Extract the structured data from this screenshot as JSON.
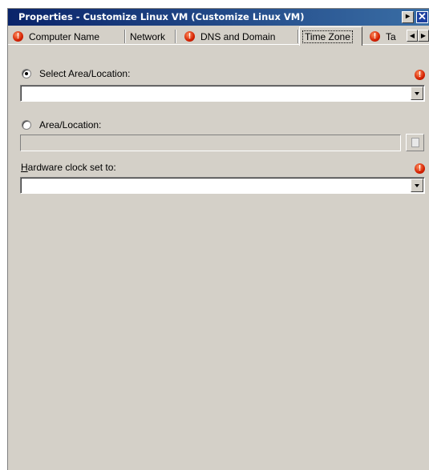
{
  "window": {
    "title": "Properties - Customize Linux VM (Customize Linux VM)",
    "menu_glyph": "▸",
    "close_glyph": "✕"
  },
  "tabs": [
    {
      "label": "Computer Name",
      "error": true
    },
    {
      "label": "Network",
      "error": false
    },
    {
      "label": "DNS and Domain",
      "error": true
    },
    {
      "label": "Time Zone",
      "error": false,
      "active": true
    },
    {
      "label": "Ta",
      "error": true
    }
  ],
  "tab_scroll": {
    "left": "◀",
    "right": "▶"
  },
  "form": {
    "select_area": {
      "label": "Select Area/Location:",
      "selected": true,
      "value": "",
      "error": true
    },
    "area_location": {
      "label": "Area/Location:",
      "selected": false,
      "value": ""
    },
    "hardware_clock": {
      "label_prefix": "H",
      "label_rest": "ardware clock set to:",
      "value": "",
      "error": true
    }
  },
  "error_glyph": "!",
  "colors": {
    "titlebar_start": "#0a246a",
    "titlebar_end": "#3a6ea5",
    "dialog_bg": "#d4d0c8",
    "error_icon": "#d42000"
  }
}
